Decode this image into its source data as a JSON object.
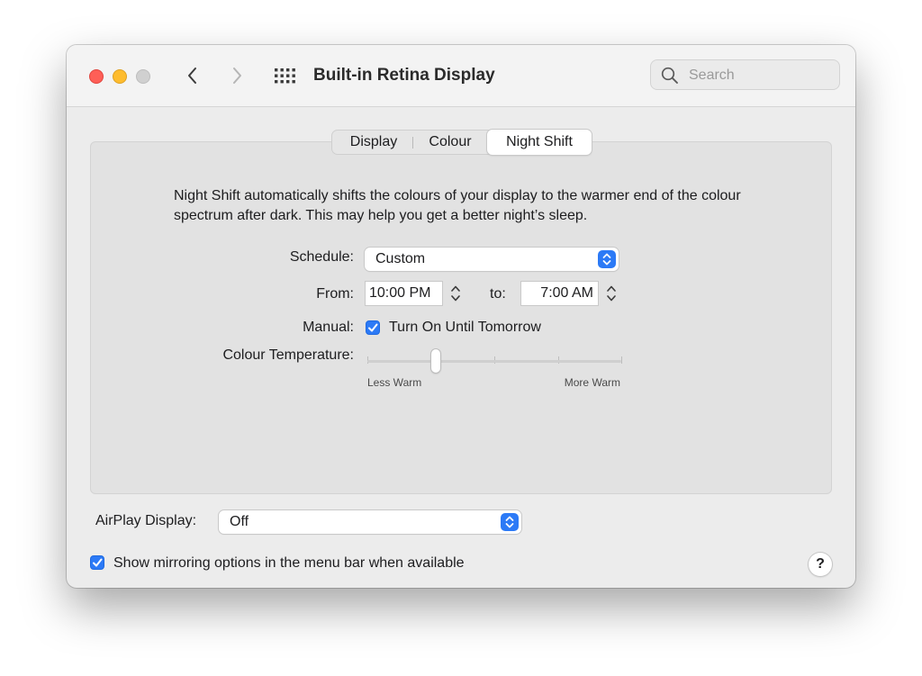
{
  "window": {
    "title": "Built-in Retina Display"
  },
  "search": {
    "placeholder": "Search",
    "value": ""
  },
  "tabs": [
    {
      "label": "Display",
      "selected": false
    },
    {
      "label": "Colour",
      "selected": false
    },
    {
      "label": "Night Shift",
      "selected": true
    }
  ],
  "night_shift": {
    "description": "Night Shift automatically shifts the colours of your display to the warmer end of the colour spectrum after dark. This may help you get a better night’s sleep.",
    "schedule": {
      "label": "Schedule:",
      "value": "Custom"
    },
    "from": {
      "label": "From:",
      "value": "10:00 PM"
    },
    "to": {
      "label": "to:",
      "value": "7:00 AM"
    },
    "manual": {
      "label": "Manual:",
      "checkbox_label": "Turn On Until Tomorrow",
      "checked": true
    },
    "colour_temperature": {
      "label": "Colour Temperature:",
      "min_label": "Less Warm",
      "max_label": "More Warm",
      "level": 0.27,
      "tick_count": 3
    }
  },
  "airplay": {
    "label": "AirPlay Display:",
    "value": "Off"
  },
  "mirroring": {
    "label": "Show mirroring options in the menu bar when available",
    "checked": true
  },
  "help": {
    "label": "?"
  },
  "colors": {
    "accent": "#2c7af6",
    "close": "#fe5f57",
    "minimize": "#febc2e",
    "zoom_inactive": "#d0d0d0"
  },
  "icons": [
    "chevron-left-icon",
    "chevron-right-icon",
    "grid-icon",
    "search-icon",
    "up-down-arrows-icon",
    "checkmark-icon"
  ]
}
